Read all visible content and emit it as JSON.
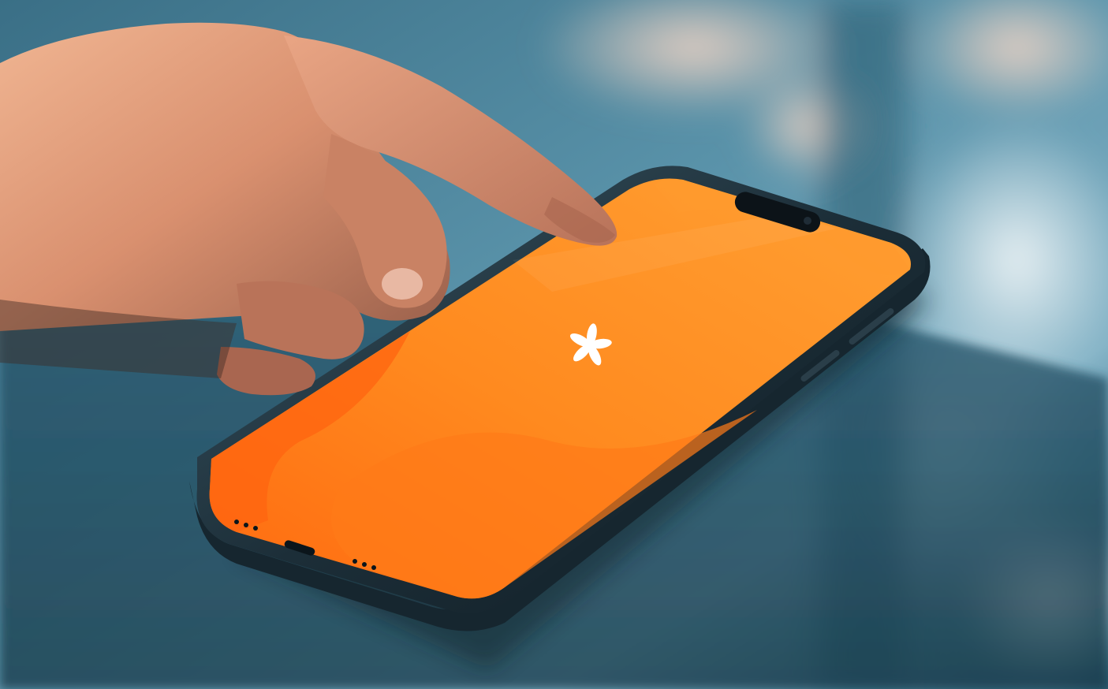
{
  "scene": {
    "subject": "smartphone-with-orange-screen",
    "background_palette": {
      "deep_teal": "#1f4a5c",
      "mid_teal": "#3f7f96",
      "light_blue": "#9fc2d3",
      "bokeh_peach": "#e8c9b8",
      "bokeh_white": "#e9f1f4"
    },
    "phone": {
      "frame_color": "#1c2e38",
      "screen_orange": "#ff8a1f",
      "screen_orange_dark": "#ff6a10",
      "screen_orange_light": "#ffa033",
      "dynamic_island_color": "#0c1318"
    },
    "app_logo": {
      "icon": "asterisk-flower-logo-icon",
      "color": "#ffffff"
    },
    "hand": {
      "skin_color": "#d9906f",
      "skin_shadow": "#8e5a48",
      "skin_highlight": "#f0b592"
    }
  }
}
